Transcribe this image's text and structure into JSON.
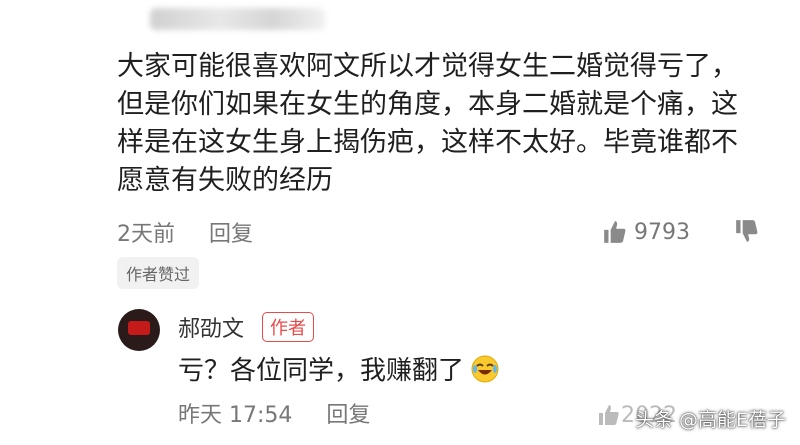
{
  "comment": {
    "text": "大家可能很喜欢阿文所以才觉得女生二婚觉得亏了，但是你们如果在女生的角度，本身二婚就是个痛，这样是在这女生身上揭伤疤，这样不太好。毕竟谁都不愿意有失败的经历",
    "time": "2天前",
    "reply_label": "回复",
    "like_count": "9793",
    "author_liked_badge": "作者赞过"
  },
  "reply": {
    "author_name": "郝劭文",
    "author_tag": "作者",
    "text": "亏？各位同学，我赚翻了",
    "emoji_icon": "rolling-laughing-emoji",
    "time": "昨天 17:54",
    "reply_label": "回复",
    "like_count": "2022"
  },
  "watermark": "头条 @高能E蓓子",
  "colors": {
    "accent_red": "#e84a4a",
    "meta_gray": "#777777"
  }
}
